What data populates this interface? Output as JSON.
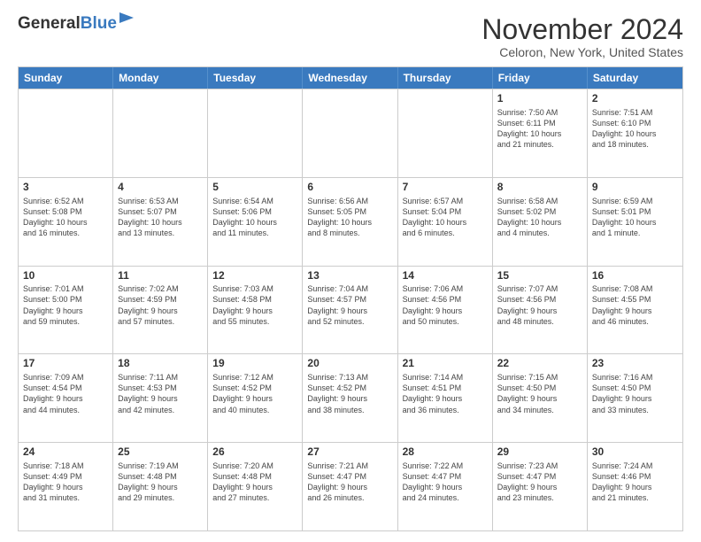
{
  "header": {
    "logo_general": "General",
    "logo_blue": "Blue",
    "month": "November 2024",
    "location": "Celoron, New York, United States"
  },
  "days_of_week": [
    "Sunday",
    "Monday",
    "Tuesday",
    "Wednesday",
    "Thursday",
    "Friday",
    "Saturday"
  ],
  "weeks": [
    [
      {
        "day": "",
        "info": ""
      },
      {
        "day": "",
        "info": ""
      },
      {
        "day": "",
        "info": ""
      },
      {
        "day": "",
        "info": ""
      },
      {
        "day": "",
        "info": ""
      },
      {
        "day": "1",
        "info": "Sunrise: 7:50 AM\nSunset: 6:11 PM\nDaylight: 10 hours\nand 21 minutes."
      },
      {
        "day": "2",
        "info": "Sunrise: 7:51 AM\nSunset: 6:10 PM\nDaylight: 10 hours\nand 18 minutes."
      }
    ],
    [
      {
        "day": "3",
        "info": "Sunrise: 6:52 AM\nSunset: 5:08 PM\nDaylight: 10 hours\nand 16 minutes."
      },
      {
        "day": "4",
        "info": "Sunrise: 6:53 AM\nSunset: 5:07 PM\nDaylight: 10 hours\nand 13 minutes."
      },
      {
        "day": "5",
        "info": "Sunrise: 6:54 AM\nSunset: 5:06 PM\nDaylight: 10 hours\nand 11 minutes."
      },
      {
        "day": "6",
        "info": "Sunrise: 6:56 AM\nSunset: 5:05 PM\nDaylight: 10 hours\nand 8 minutes."
      },
      {
        "day": "7",
        "info": "Sunrise: 6:57 AM\nSunset: 5:04 PM\nDaylight: 10 hours\nand 6 minutes."
      },
      {
        "day": "8",
        "info": "Sunrise: 6:58 AM\nSunset: 5:02 PM\nDaylight: 10 hours\nand 4 minutes."
      },
      {
        "day": "9",
        "info": "Sunrise: 6:59 AM\nSunset: 5:01 PM\nDaylight: 10 hours\nand 1 minute."
      }
    ],
    [
      {
        "day": "10",
        "info": "Sunrise: 7:01 AM\nSunset: 5:00 PM\nDaylight: 9 hours\nand 59 minutes."
      },
      {
        "day": "11",
        "info": "Sunrise: 7:02 AM\nSunset: 4:59 PM\nDaylight: 9 hours\nand 57 minutes."
      },
      {
        "day": "12",
        "info": "Sunrise: 7:03 AM\nSunset: 4:58 PM\nDaylight: 9 hours\nand 55 minutes."
      },
      {
        "day": "13",
        "info": "Sunrise: 7:04 AM\nSunset: 4:57 PM\nDaylight: 9 hours\nand 52 minutes."
      },
      {
        "day": "14",
        "info": "Sunrise: 7:06 AM\nSunset: 4:56 PM\nDaylight: 9 hours\nand 50 minutes."
      },
      {
        "day": "15",
        "info": "Sunrise: 7:07 AM\nSunset: 4:56 PM\nDaylight: 9 hours\nand 48 minutes."
      },
      {
        "day": "16",
        "info": "Sunrise: 7:08 AM\nSunset: 4:55 PM\nDaylight: 9 hours\nand 46 minutes."
      }
    ],
    [
      {
        "day": "17",
        "info": "Sunrise: 7:09 AM\nSunset: 4:54 PM\nDaylight: 9 hours\nand 44 minutes."
      },
      {
        "day": "18",
        "info": "Sunrise: 7:11 AM\nSunset: 4:53 PM\nDaylight: 9 hours\nand 42 minutes."
      },
      {
        "day": "19",
        "info": "Sunrise: 7:12 AM\nSunset: 4:52 PM\nDaylight: 9 hours\nand 40 minutes."
      },
      {
        "day": "20",
        "info": "Sunrise: 7:13 AM\nSunset: 4:52 PM\nDaylight: 9 hours\nand 38 minutes."
      },
      {
        "day": "21",
        "info": "Sunrise: 7:14 AM\nSunset: 4:51 PM\nDaylight: 9 hours\nand 36 minutes."
      },
      {
        "day": "22",
        "info": "Sunrise: 7:15 AM\nSunset: 4:50 PM\nDaylight: 9 hours\nand 34 minutes."
      },
      {
        "day": "23",
        "info": "Sunrise: 7:16 AM\nSunset: 4:50 PM\nDaylight: 9 hours\nand 33 minutes."
      }
    ],
    [
      {
        "day": "24",
        "info": "Sunrise: 7:18 AM\nSunset: 4:49 PM\nDaylight: 9 hours\nand 31 minutes."
      },
      {
        "day": "25",
        "info": "Sunrise: 7:19 AM\nSunset: 4:48 PM\nDaylight: 9 hours\nand 29 minutes."
      },
      {
        "day": "26",
        "info": "Sunrise: 7:20 AM\nSunset: 4:48 PM\nDaylight: 9 hours\nand 27 minutes."
      },
      {
        "day": "27",
        "info": "Sunrise: 7:21 AM\nSunset: 4:47 PM\nDaylight: 9 hours\nand 26 minutes."
      },
      {
        "day": "28",
        "info": "Sunrise: 7:22 AM\nSunset: 4:47 PM\nDaylight: 9 hours\nand 24 minutes."
      },
      {
        "day": "29",
        "info": "Sunrise: 7:23 AM\nSunset: 4:47 PM\nDaylight: 9 hours\nand 23 minutes."
      },
      {
        "day": "30",
        "info": "Sunrise: 7:24 AM\nSunset: 4:46 PM\nDaylight: 9 hours\nand 21 minutes."
      }
    ]
  ]
}
